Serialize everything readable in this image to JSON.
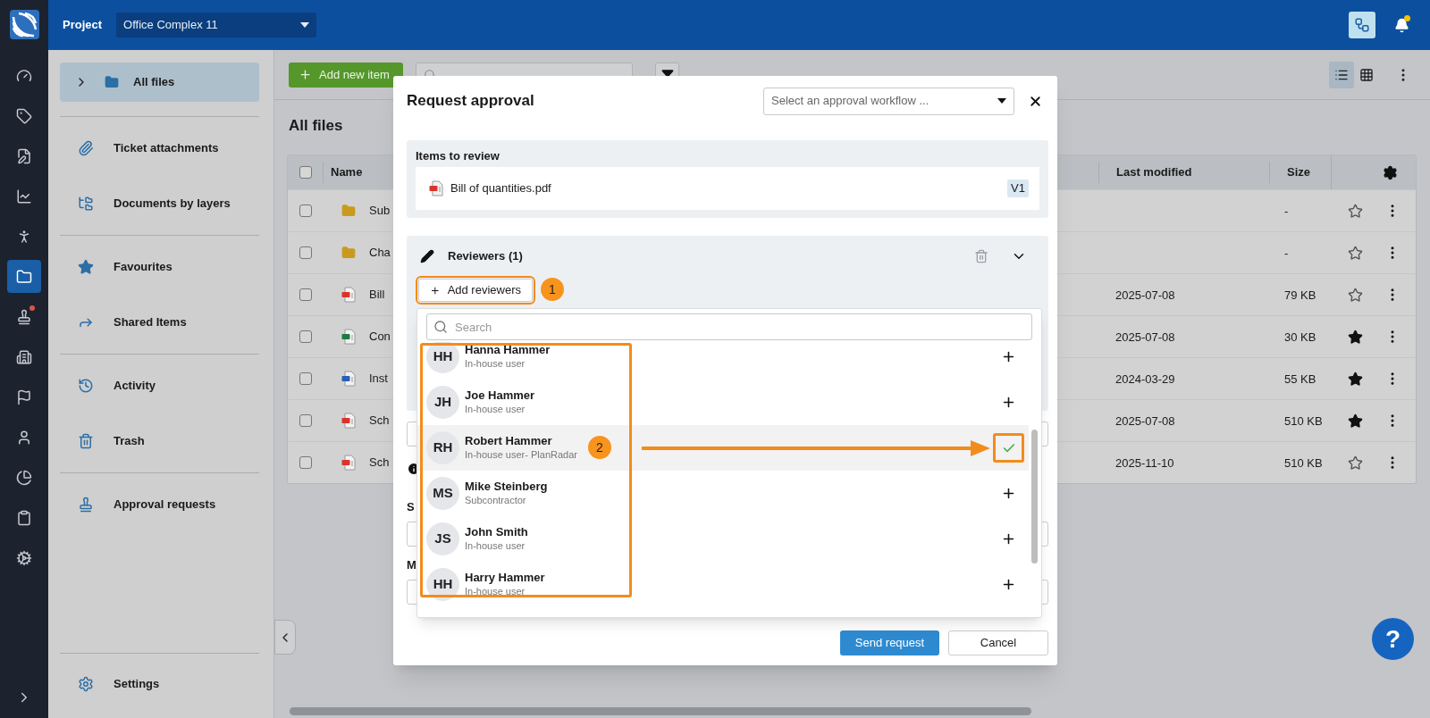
{
  "header": {
    "project_label": "Project",
    "project": "Office Complex 11",
    "notification": true
  },
  "rail": {
    "items": [
      {
        "selected": false,
        "badge": false
      },
      {
        "selected": false,
        "badge": false
      },
      {
        "selected": false,
        "badge": false
      },
      {
        "selected": false,
        "badge": false
      },
      {
        "selected": false,
        "badge": false
      },
      {
        "selected": true,
        "badge": false
      },
      {
        "selected": false,
        "badge": true
      },
      {
        "selected": false,
        "badge": false
      },
      {
        "selected": false,
        "badge": false
      },
      {
        "selected": false,
        "badge": false
      },
      {
        "selected": false,
        "badge": false
      },
      {
        "selected": false,
        "badge": false
      },
      {
        "selected": false,
        "badge": false
      }
    ]
  },
  "sidebar": {
    "top": {
      "label": "All files",
      "selected": true
    },
    "groups": [
      [
        {
          "label": "Ticket attachments",
          "selected": false
        },
        {
          "label": "Documents by layers",
          "selected": false
        }
      ],
      [
        {
          "label": "Favourites",
          "selected": false
        },
        {
          "label": "Shared Items",
          "selected": false
        }
      ],
      [
        {
          "label": "Activity",
          "selected": false
        },
        {
          "label": "Trash",
          "selected": false
        }
      ],
      [
        {
          "label": "Approval requests",
          "selected": false
        }
      ]
    ],
    "settings": "Settings"
  },
  "toolbar": {
    "add_button": "Add new item",
    "views": [
      {
        "selected": true
      },
      {
        "selected": false
      }
    ]
  },
  "page_title": "All files",
  "table": {
    "all_checked": false,
    "columns": [
      "Name",
      "Last modified",
      "Size"
    ],
    "rows": [
      {
        "kind": "folder",
        "name": "Sub",
        "size": "-",
        "favourite": false,
        "checked": false
      },
      {
        "kind": "folder",
        "name": "Cha",
        "size": "-",
        "favourite": false,
        "checked": false
      },
      {
        "kind": "pdf",
        "name": "Bill",
        "modified": "2025-07-08",
        "size": "79 KB",
        "favourite": false,
        "checked": false
      },
      {
        "kind": "excel",
        "name": "Con",
        "modified": "2025-07-08",
        "size": "30 KB",
        "favourite": true,
        "checked": false
      },
      {
        "kind": "word",
        "name": "Inst",
        "modified": "2024-03-29",
        "size": "55 KB",
        "favourite": true,
        "checked": false
      },
      {
        "kind": "pdf",
        "name": "Sch",
        "modified": "2025-07-08",
        "size": "510 KB",
        "favourite": true,
        "checked": false
      },
      {
        "kind": "pdf",
        "name": "Sch",
        "modified": "2025-11-10",
        "size": "510 KB",
        "favourite": false,
        "checked": false
      }
    ]
  },
  "modal": {
    "title": "Request approval",
    "workflow_placeholder": "Select an approval workflow ...",
    "items_heading": "Items to review",
    "items": [
      {
        "kind": "pdf",
        "name": "Bill of quantities.pdf",
        "version": "V1"
      }
    ],
    "reviewers": {
      "heading": "Reviewers (1)",
      "expanded": true,
      "add_button": "Add reviewers"
    },
    "picker": {
      "search_placeholder": "Search",
      "users": [
        {
          "initials": "HH",
          "name": "Hanna Hammer",
          "role": "In-house user",
          "selected": false
        },
        {
          "initials": "JH",
          "name": "Joe Hammer",
          "role": "In-house user",
          "selected": false
        },
        {
          "initials": "RH",
          "name": "Robert Hammer",
          "role": "In-house user- PlanRadar",
          "selected": true
        },
        {
          "initials": "MS",
          "name": "Mike Steinberg",
          "role": "Subcontractor",
          "selected": false
        },
        {
          "initials": "JS",
          "name": "John Smith",
          "role": "In-house user",
          "selected": false
        },
        {
          "initials": "HH",
          "name": "Harry Hammer",
          "role": "In-house user",
          "selected": false
        }
      ]
    },
    "labels": [
      "S",
      "M"
    ],
    "send": "Send request",
    "cancel": "Cancel"
  },
  "callouts": [
    "1",
    "2"
  ],
  "help": "?"
}
